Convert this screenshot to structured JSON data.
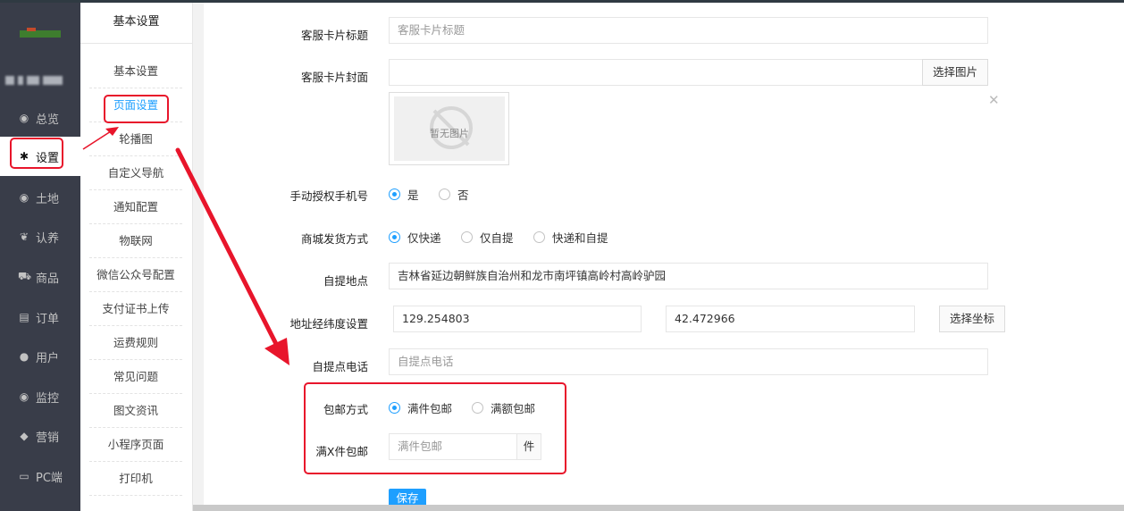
{
  "sidebar": {
    "items": [
      {
        "label": "总览",
        "icon": "dashboard-icon",
        "glyph": "◉"
      },
      {
        "label": "设置",
        "icon": "gear-icon",
        "glyph": "✱"
      },
      {
        "label": "土地",
        "icon": "globe-icon",
        "glyph": "◉"
      },
      {
        "label": "认养",
        "icon": "bird-icon",
        "glyph": "❦"
      },
      {
        "label": "商品",
        "icon": "cart-icon",
        "glyph": "⛟"
      },
      {
        "label": "订单",
        "icon": "list-icon",
        "glyph": "▤"
      },
      {
        "label": "用户",
        "icon": "user-icon",
        "glyph": "●"
      },
      {
        "label": "监控",
        "icon": "camera-icon",
        "glyph": "◉"
      },
      {
        "label": "营销",
        "icon": "tag-icon",
        "glyph": "◆"
      },
      {
        "label": "PC端",
        "icon": "monitor-icon",
        "glyph": "▭"
      }
    ]
  },
  "submenu": {
    "title": "基本设置",
    "items": [
      "基本设置",
      "页面设置",
      "轮播图",
      "自定义导航",
      "通知配置",
      "物联网",
      "微信公众号配置",
      "支付证书上传",
      "运费规则",
      "常见问题",
      "图文资讯",
      "小程序页面",
      "打印机"
    ]
  },
  "form": {
    "card_title": {
      "label": "客服卡片标题",
      "placeholder": "客服卡片标题"
    },
    "card_cover": {
      "label": "客服卡片封面",
      "button": "选择图片",
      "no_image": "暂无图片"
    },
    "manual_phone": {
      "label": "手动授权手机号",
      "options": [
        "是",
        "否"
      ],
      "selected": "是"
    },
    "shipping_mode": {
      "label": "商城发货方式",
      "options": [
        "仅快递",
        "仅自提",
        "快递和自提"
      ],
      "selected": "仅快递"
    },
    "pickup_address": {
      "label": "自提地点",
      "value": "吉林省延边朝鲜族自治州和龙市南坪镇高岭村高岭驴园"
    },
    "coords": {
      "label": "地址经纬度设置",
      "lng": "129.254803",
      "lat": "42.472966",
      "button": "选择坐标"
    },
    "pickup_phone": {
      "label": "自提点电话",
      "placeholder": "自提点电话"
    },
    "free_shipping": {
      "label": "包邮方式",
      "options": [
        "满件包邮",
        "满额包邮"
      ],
      "selected": "满件包邮"
    },
    "free_qty": {
      "label": "满X件包邮",
      "placeholder": "满件包邮",
      "suffix": "件"
    },
    "save": "保存"
  },
  "colors": {
    "accent": "#1e9fff",
    "sidebar": "#393d49",
    "annotation": "#e8152b"
  }
}
